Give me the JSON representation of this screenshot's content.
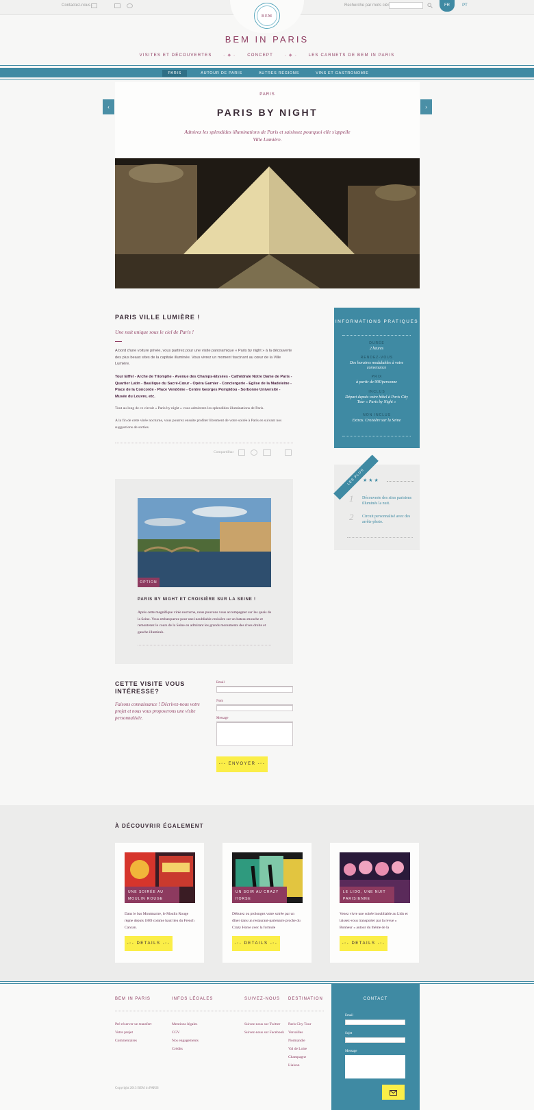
{
  "topbar": {
    "contact_label": "Contactez-nous :",
    "search_label": "Recherche par mots clés :",
    "lang_fr": "FR",
    "lang_pt": "PT"
  },
  "logo": {
    "text": "BEM"
  },
  "brand": "BEM IN PARIS",
  "nav": {
    "items": [
      "VISITES ET DÉCOUVERTES",
      "CONCEPT",
      "LES CARNETS DE BEM IN PARIS"
    ],
    "separator": "- ◆ -"
  },
  "subnav": {
    "items": [
      "PARIS",
      "AUTOUR DE PARIS",
      "AUTRES RÉGIONS",
      "VINS ET GASTRONOMIE"
    ]
  },
  "article": {
    "crumb": "PARIS",
    "title": "PARIS BY NIGHT",
    "intro": "Admirez les splendides illuminations de Paris et saisissez pourquoi elle s'appelle Ville Lumière."
  },
  "section": {
    "title": "PARIS VILLE LUMIÈRE !",
    "subtitle": "Une nuit unique sous le ciel de Paris !",
    "p1": "A bord d'une voiture privée, vous partirez pour une visite panoramique « Paris by night » à la découverte des plus beaux sites de la capitale illuminée. Vous vivrez un moment fascinant au cœur de la Ville Lumière.",
    "p2": "Tour Eiffel - Arche de Triomphe - Avenue des Champs-Elysées - Cathédrale Notre Dame de Paris - Quartier Latin - Basilique du Sacré-Cœur - Opéra Garnier - Conciergerie - Eglise de la Madeleine - Place de la Concorde - Place Vendôme - Centre Georges Pompidou - Sorbonne Université - Musée du Louvre, etc.",
    "p3": "Tout au long de ce circuit « Paris by night » vous admirerez les splendides illuminations de Paris.",
    "p4": "A la fin de cette virée nocturne, vous pourrez ensuite profiter librement de votre soirée à Paris en suivant nos suggestions de sorties.",
    "share_label": "Compartilhar"
  },
  "info": {
    "title": "INFORMATIONS PRATIQUES",
    "rows": [
      {
        "k": "DURÉE",
        "v": "2 heures"
      },
      {
        "k": "RENDEZ-VOUS",
        "v": "Des horaires modulables à votre convenance"
      },
      {
        "k": "PRIX",
        "v": "à partir de 90€/personne"
      },
      {
        "k": "INCLUS",
        "v": "Départ depuis votre hôtel à Paris City Tour « Paris by Night »"
      },
      {
        "k": "NON INCLUS",
        "v": "Extras. Croisière sur la Seine"
      }
    ]
  },
  "plus": {
    "ribbon": "LES PLUS",
    "stars": "★★★",
    "items": [
      {
        "num": "1",
        "text": "Découverte des sites parisiens illuminés la nuit."
      },
      {
        "num": "2",
        "text": "Circuit personnalisé avec des arrêts-photo."
      }
    ]
  },
  "option": {
    "badge": "OPTION",
    "title": "PARIS BY NIGHT ET CROISIÈRE SUR LA SEINE !",
    "text": "Après cette magnifique virée nocturne, nous pouvons vous accompagner sur les quais de la Seine. Vous embarquerez pour une inoubliable croisière sur un bateau mouche et remonterez le cours de la Seine en admirant les grands monuments des rives droite et gauche illuminés."
  },
  "interest": {
    "title": "CETTE VISITE VOUS INTÉRESSE?",
    "text": "Faisons connaissance ! Décrivez-nous votre projet et nous vous proposerons une visite personnalisée.",
    "email_label": "Email",
    "nom_label": "Nom",
    "message_label": "Message",
    "submit": "-◦- ENVOYER -◦-"
  },
  "discover": {
    "title": "À DÉCOUVRIR ÉGALEMENT",
    "cards": [
      {
        "badge": "UNE SOIRÉE AU MOULIN ROUGE",
        "text": "Dans le bas Montmartre, le Moulin Rouge règne depuis 1889 comme haut lieu du French Cancan.",
        "button": "-◦- DETAILS -◦-"
      },
      {
        "badge": "UN SOIR AU CRAZY HORSE",
        "text": "Débutez ou prolongez votre soirée par un dîner dans un restaurant-partenaire proche du Crazy Horse avec la formule",
        "button": "-◦- DETAILS -◦-"
      },
      {
        "badge": "LE LIDO, UNE NUIT PARISIENNE",
        "text": "Venez vivre une soirée inoubliable au Lido et laissez-vous transporter par la revue « Bonheur » autour du thème de la",
        "button": "-◦- DETAILS -◦-"
      }
    ]
  },
  "footer": {
    "brand": "BEM IN PARIS",
    "col_legal": "INFOS LÉGALES",
    "col_follow": "SUIVEZ-NOUS",
    "col_dest": "DESTINATION",
    "links1": [
      "Pré-réserver un transfert",
      "Votre projet",
      "Commentaires"
    ],
    "links2": [
      "Mentions légales",
      "CGV",
      "Nos engagements",
      "Crédits"
    ],
    "links3": [
      "Suivez-nous sur Twitter",
      "Suivez-nous sur Facebook"
    ],
    "links4": [
      "Paris City Tour",
      "Versailles",
      "Normandie",
      "Val de Loire",
      "Champagne",
      "Liaison"
    ],
    "copyright": "Copyright 2013 BEM in PARIS",
    "contact_title": "CONTACT",
    "contact_email": "Email",
    "contact_sujet": "Sujet",
    "contact_message": "Message",
    "send_icon": "envelope-icon"
  }
}
